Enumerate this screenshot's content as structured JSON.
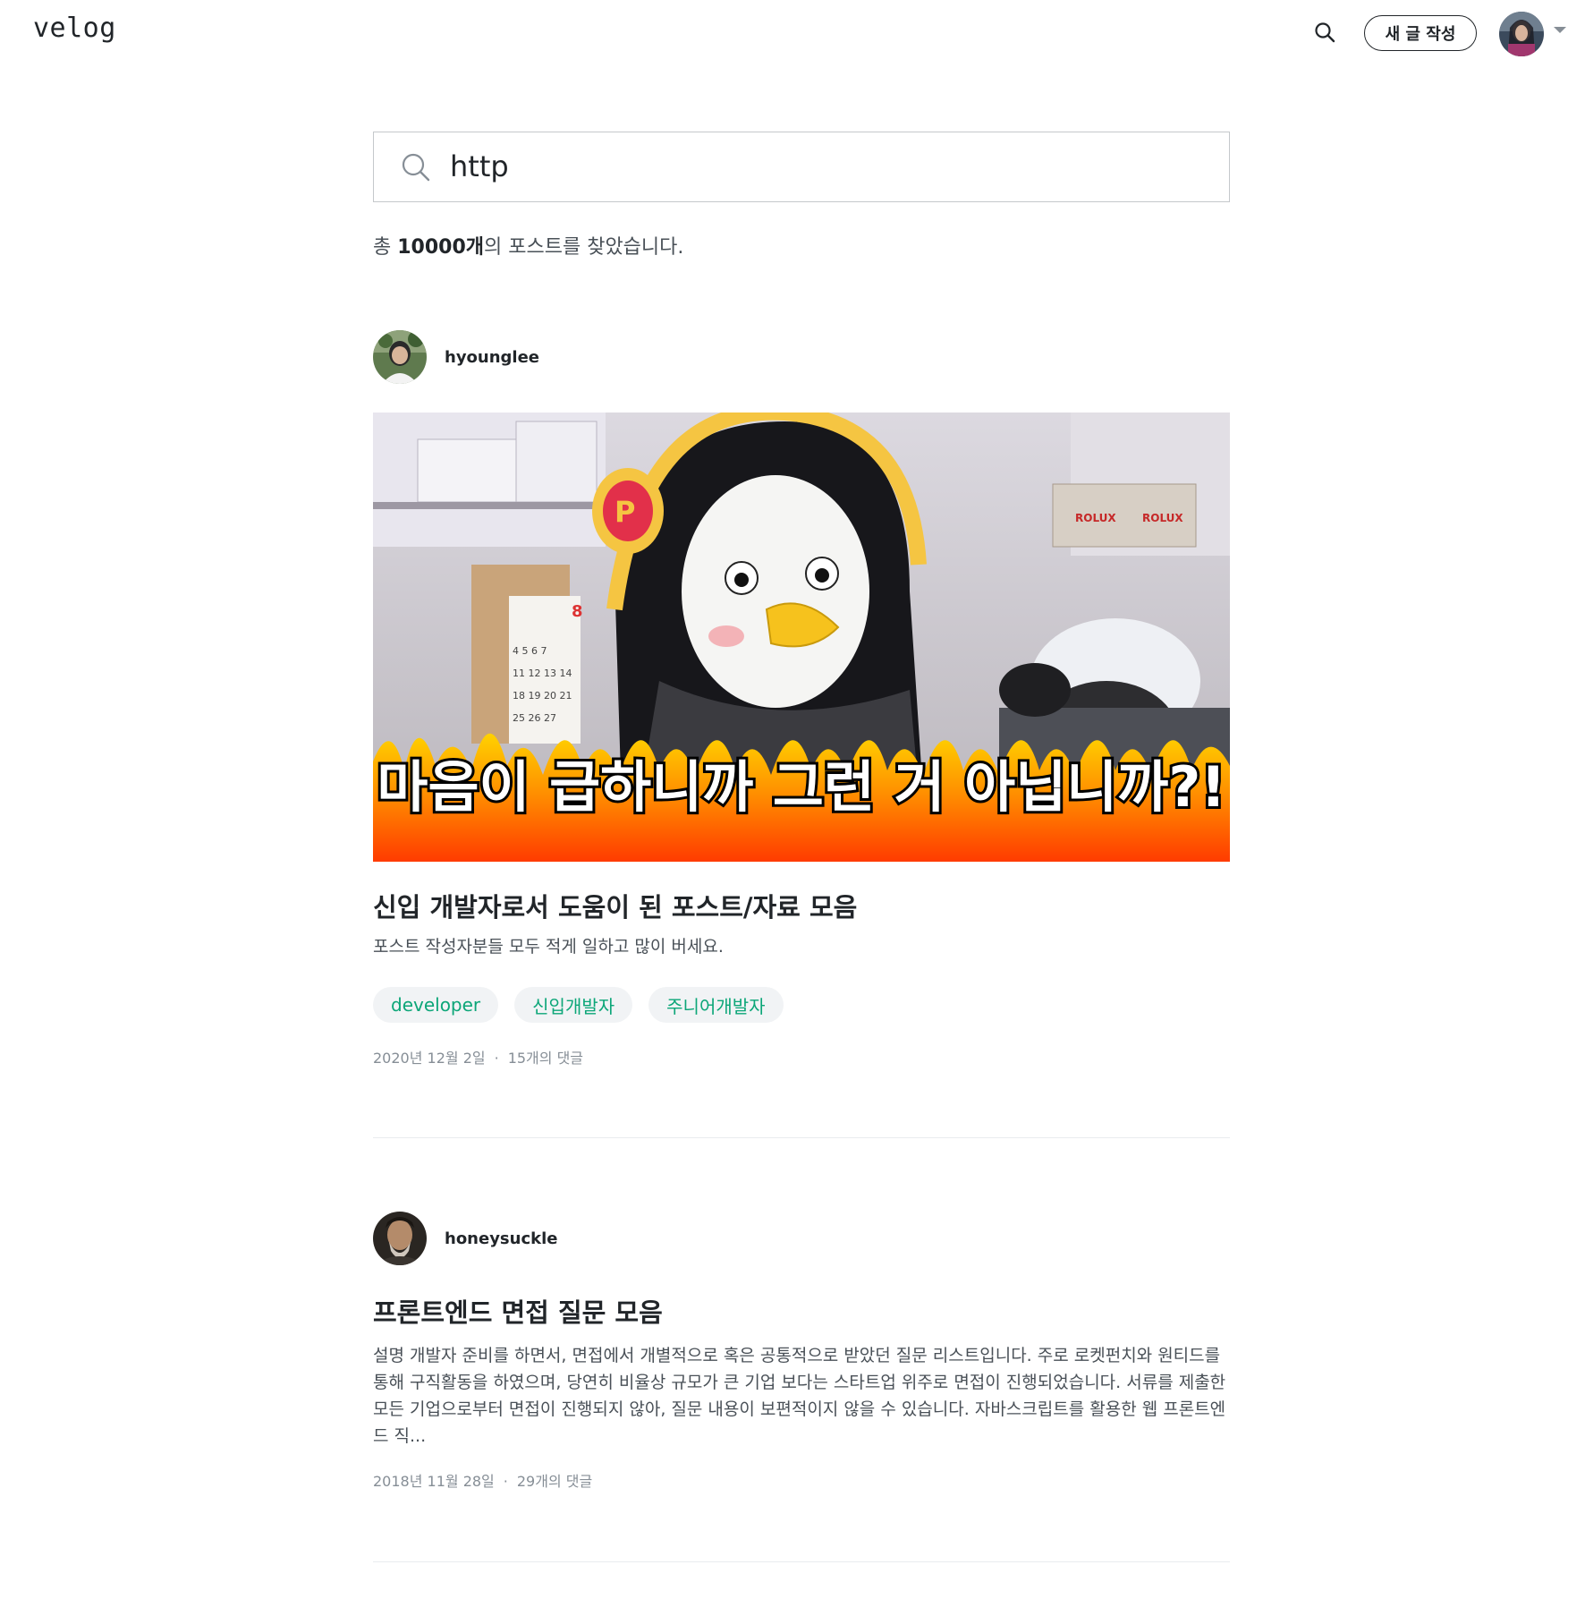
{
  "header": {
    "logo": "velog",
    "write_label": "새 글 작성"
  },
  "search": {
    "query": "http"
  },
  "result": {
    "prefix": "총 ",
    "count": "10000개",
    "suffix": "의 포스트를 찾았습니다."
  },
  "posts": [
    {
      "username": "hyounglee",
      "thumbnail_caption": "마음이 급하니까 그런 거 아닙니까?!",
      "title": "신입 개발자로서 도움이 된 포스트/자료 모음",
      "description": "포스트 작성자분들 모두 적게 일하고 많이 버세요.",
      "tags": [
        "developer",
        "신입개발자",
        "주니어개발자"
      ],
      "date": "2020년 12월 2일",
      "comments": "15개의 댓글"
    },
    {
      "username": "honeysuckle",
      "title": "프론트엔드 면접 질문 모음",
      "description": "설명 개발자 준비를 하면서, 면접에서 개별적으로 혹은 공통적으로 받았던 질문 리스트입니다. 주로 로켓펀치와 원티드를 통해 구직활동을 하였으며, 당연히 비율상 규모가 큰 기업 보다는 스타트업 위주로 면접이 진행되었습니다. 서류를 제출한 모든 기업으로부터 면접이 진행되지 않아, 질문 내용이 보편적이지 않을 수 있습니다. 자바스크립트를 활용한 웹 프론트엔드 직...",
      "date": "2018년 11월 28일",
      "comments": "29개의 댓글"
    }
  ],
  "colors": {
    "tag_text": "#0ca678",
    "tag_bg": "#f1f3f5",
    "meta_text": "#868e96"
  },
  "icons": {
    "header_search": "search-icon",
    "input_search": "search-icon",
    "user_menu": "caret-down-icon"
  }
}
